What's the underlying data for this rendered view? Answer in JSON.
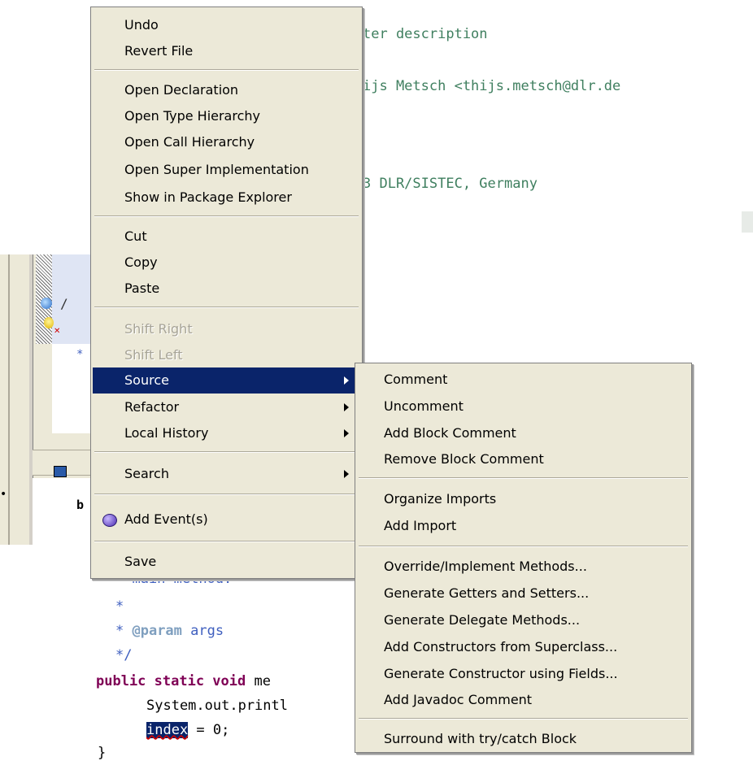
{
  "editor": {
    "lines": {
      "l1": "ter description",
      "l2": "ijs Metsch <thijs.metsch@dlr.de",
      "l3": "3 DLR/SISTEC, Germany",
      "l4": "* main method.",
      "l5": "*",
      "l6a": "* ",
      "l6b": "@param",
      "l6c": " args",
      "l7": "*/",
      "l8a": "public static void",
      "l8b": " me",
      "l9": "System.out.printl",
      "l10a": "index",
      "l10b": " = 0;",
      "l11": "}"
    },
    "left_fragments": {
      "slash": "/",
      "star": "*",
      "b": "b",
      "dot": "•"
    }
  },
  "context_menu": {
    "items": {
      "undo": "Undo",
      "revert_file": "Revert File",
      "open_declaration": "Open Declaration",
      "open_type_hierarchy": "Open Type Hierarchy",
      "open_call_hierarchy": "Open Call Hierarchy",
      "open_super_implementation": "Open Super Implementation",
      "show_in_package_explorer": "Show in Package Explorer",
      "cut": "Cut",
      "copy": "Copy",
      "paste": "Paste",
      "shift_right": "Shift Right",
      "shift_left": "Shift Left",
      "source": "Source",
      "refactor": "Refactor",
      "local_history": "Local History",
      "search": "Search",
      "add_events": "Add Event(s)",
      "save": "Save"
    }
  },
  "source_submenu": {
    "items": {
      "comment": "Comment",
      "uncomment": "Uncomment",
      "add_block_comment": "Add Block Comment",
      "remove_block_comment": "Remove Block Comment",
      "organize_imports": "Organize Imports",
      "add_import": "Add Import",
      "override_implement": "Override/Implement Methods...",
      "generate_getters_setters": "Generate Getters and Setters...",
      "generate_delegate": "Generate Delegate Methods...",
      "add_constructors_superclass": "Add Constructors from Superclass...",
      "generate_constructor_fields": "Generate Constructor using Fields...",
      "add_javadoc": "Add Javadoc Comment",
      "surround_try_catch": "Surround with try/catch Block"
    }
  },
  "colors": {
    "menu_bg": "#ece9d8",
    "highlight": "#0a246a",
    "comment": "#3f7f5f",
    "javadoc": "#3f5fbf",
    "keyword": "#7f0055"
  },
  "icons": {
    "add_events": "add-event-icon",
    "submenu_arrow": "submenu-arrow-icon"
  }
}
